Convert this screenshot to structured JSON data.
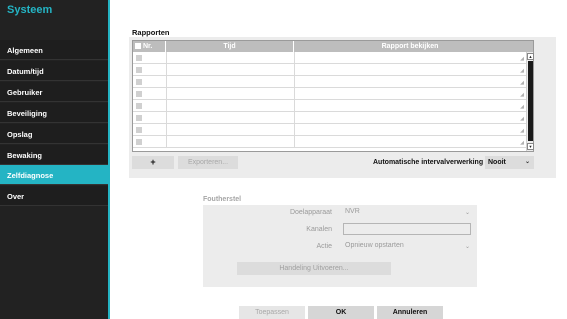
{
  "sidebar": {
    "title": "Systeem",
    "items": [
      {
        "label": "Algemeen"
      },
      {
        "label": "Datum/tijd"
      },
      {
        "label": "Gebruiker"
      },
      {
        "label": "Beveiliging"
      },
      {
        "label": "Opslag"
      },
      {
        "label": "Bewaking"
      },
      {
        "label": "Zelfdiagnose",
        "active": true
      },
      {
        "label": "Over"
      }
    ],
    "accent_color": "#24b4c4"
  },
  "reports": {
    "section_title": "Rapporten",
    "columns": [
      "Nr.",
      "Tijd",
      "Rapport bekijken"
    ],
    "rows": [
      {
        "nr": "",
        "tijd": "",
        "rapport": ""
      },
      {
        "nr": "",
        "tijd": "",
        "rapport": ""
      },
      {
        "nr": "",
        "tijd": "",
        "rapport": ""
      },
      {
        "nr": "",
        "tijd": "",
        "rapport": ""
      },
      {
        "nr": "",
        "tijd": "",
        "rapport": ""
      },
      {
        "nr": "",
        "tijd": "",
        "rapport": ""
      },
      {
        "nr": "",
        "tijd": "",
        "rapport": ""
      },
      {
        "nr": "",
        "tijd": "",
        "rapport": ""
      }
    ],
    "add_label": "+",
    "export_label": "Exporteren...",
    "auto_interval_label": "Automatische intervalverwerking",
    "auto_interval_value": "Nooit"
  },
  "fault_recovery": {
    "title": "Foutherstel",
    "device_label": "Doelapparaat",
    "device_value": "NVR",
    "channels_label": "Kanalen",
    "channels_value": "",
    "action_label": "Actie",
    "action_value": "Opnieuw opstarten",
    "run_label": "Handeling Uitvoeren..."
  },
  "footer": {
    "apply_label": "Toepassen",
    "ok_label": "OK",
    "cancel_label": "Annuleren"
  }
}
